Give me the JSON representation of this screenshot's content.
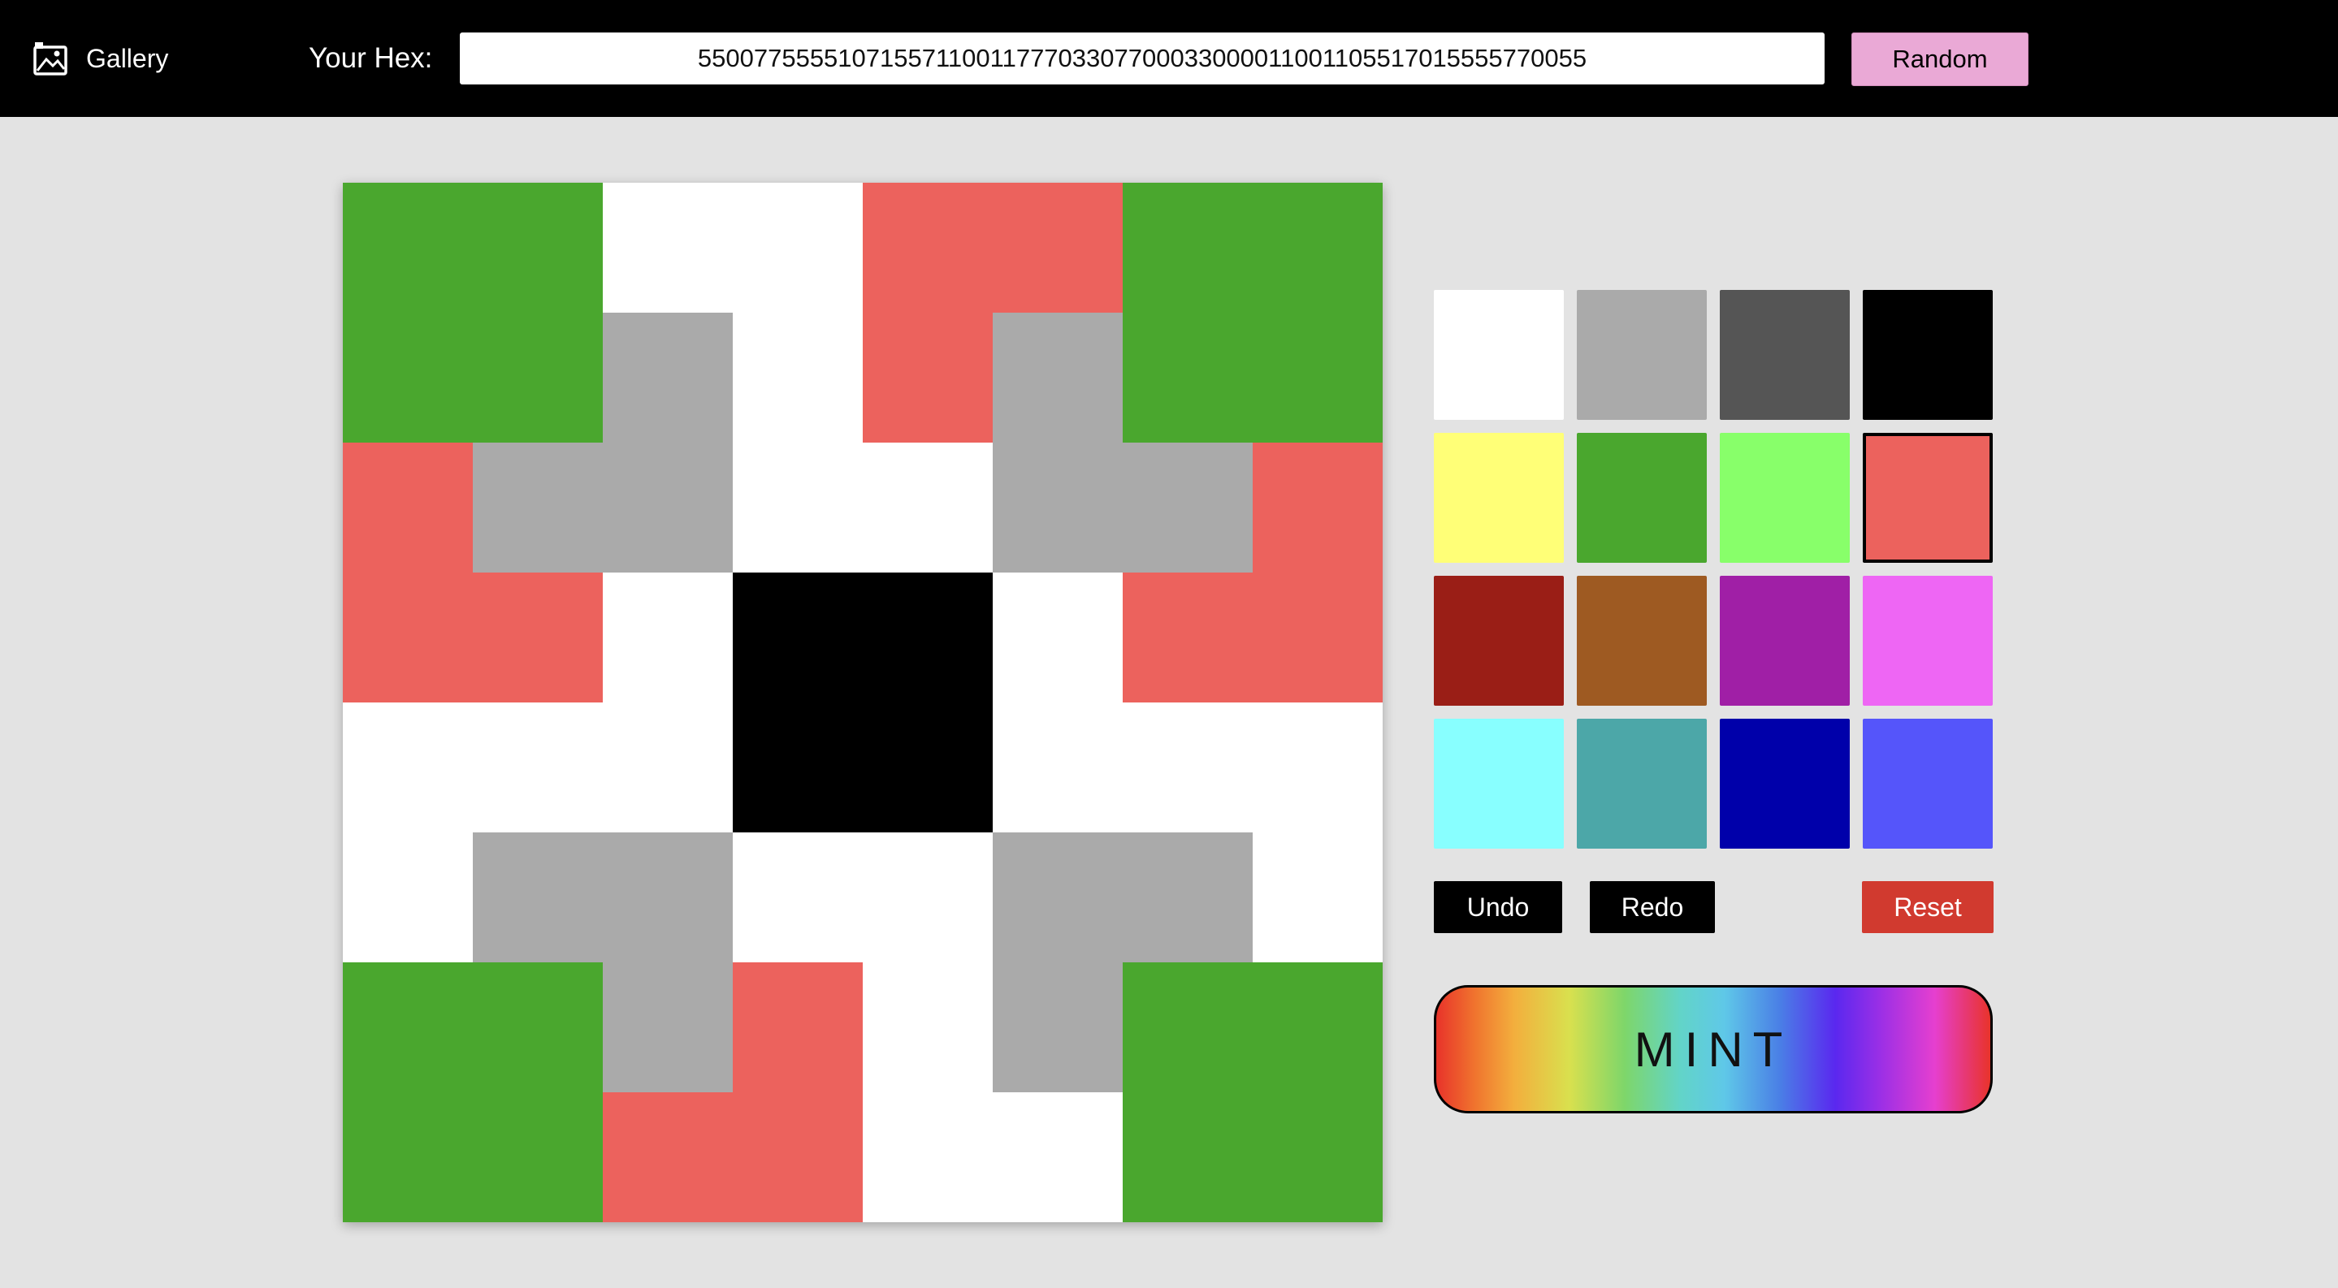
{
  "header": {
    "gallery_label": "Gallery",
    "gallery_icon": "gallery-icon",
    "hex_label": "Your Hex:",
    "hex_value": "5500775555107155711001177703307700033000011001105517015555770055",
    "random_label": "Random"
  },
  "palette": {
    "colors": [
      "#ffffff",
      "#aaaaaa",
      "#555555",
      "#000000",
      "#ffff77",
      "#4aa72e",
      "#88ff6a",
      "#ec625d",
      "#9a1e16",
      "#9e5a22",
      "#a01fa6",
      "#ee66f4",
      "#88ffff",
      "#4ca7a8",
      "#0000aa",
      "#5555fa"
    ],
    "selected_index": 7
  },
  "controls": {
    "undo_label": "Undo",
    "redo_label": "Redo",
    "reset_label": "Reset",
    "mint_label": "MINT"
  }
}
